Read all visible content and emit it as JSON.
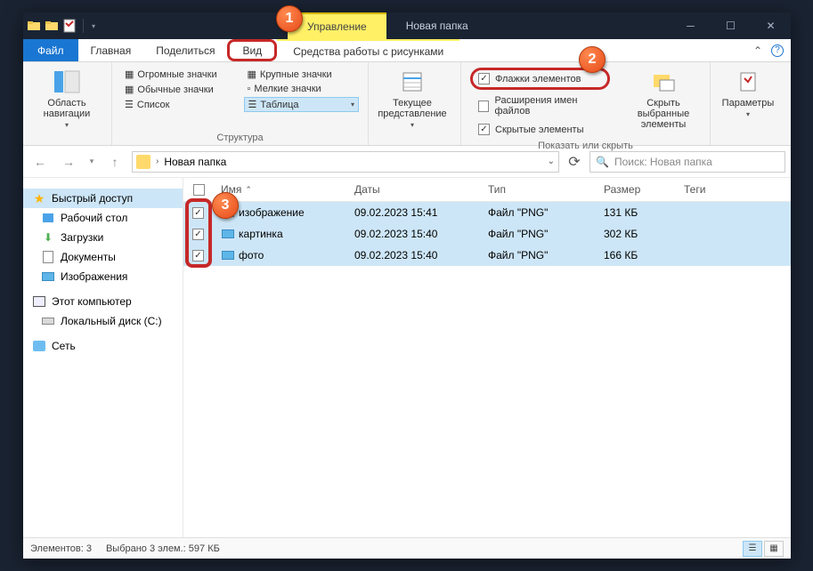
{
  "titlebar": {
    "context_tab": "Управление",
    "window_title": "Новая папка"
  },
  "tabs": {
    "file": "Файл",
    "home": "Главная",
    "share": "Поделиться",
    "view": "Вид",
    "picture_tools": "Средства работы с рисунками"
  },
  "ribbon": {
    "nav_pane": "Область навигации",
    "layout": {
      "huge": "Огромные значки",
      "large": "Крупные значки",
      "medium": "Обычные значки",
      "small": "Мелкие значки",
      "list": "Список",
      "details": "Таблица"
    },
    "layout_group": "Структура",
    "current_view": "Текущее представление",
    "checkboxes": "Флажки элементов",
    "extensions": "Расширения имен файлов",
    "hidden": "Скрытые элементы",
    "hide_selected": "Скрыть выбранные элементы",
    "show_hide_group": "Показать или скрыть",
    "options": "Параметры"
  },
  "address": {
    "crumb": "Новая папка",
    "search_placeholder": "Поиск: Новая папка"
  },
  "nav": {
    "quick_access": "Быстрый доступ",
    "desktop": "Рабочий стол",
    "downloads": "Загрузки",
    "documents": "Документы",
    "pictures": "Изображения",
    "this_pc": "Этот компьютер",
    "local_disk": "Локальный диск (C:)",
    "network": "Сеть"
  },
  "columns": {
    "name": "Имя",
    "date": "Даты",
    "type": "Тип",
    "size": "Размер",
    "tags": "Теги"
  },
  "files": [
    {
      "name": "изображение",
      "date": "09.02.2023 15:41",
      "type": "Файл \"PNG\"",
      "size": "131 КБ"
    },
    {
      "name": "картинка",
      "date": "09.02.2023 15:40",
      "type": "Файл \"PNG\"",
      "size": "302 КБ"
    },
    {
      "name": "фото",
      "date": "09.02.2023 15:40",
      "type": "Файл \"PNG\"",
      "size": "166 КБ"
    }
  ],
  "status": {
    "count": "Элементов: 3",
    "selection": "Выбрано 3 элем.: 597 КБ"
  },
  "badges": {
    "b1": "1",
    "b2": "2",
    "b3": "3"
  }
}
